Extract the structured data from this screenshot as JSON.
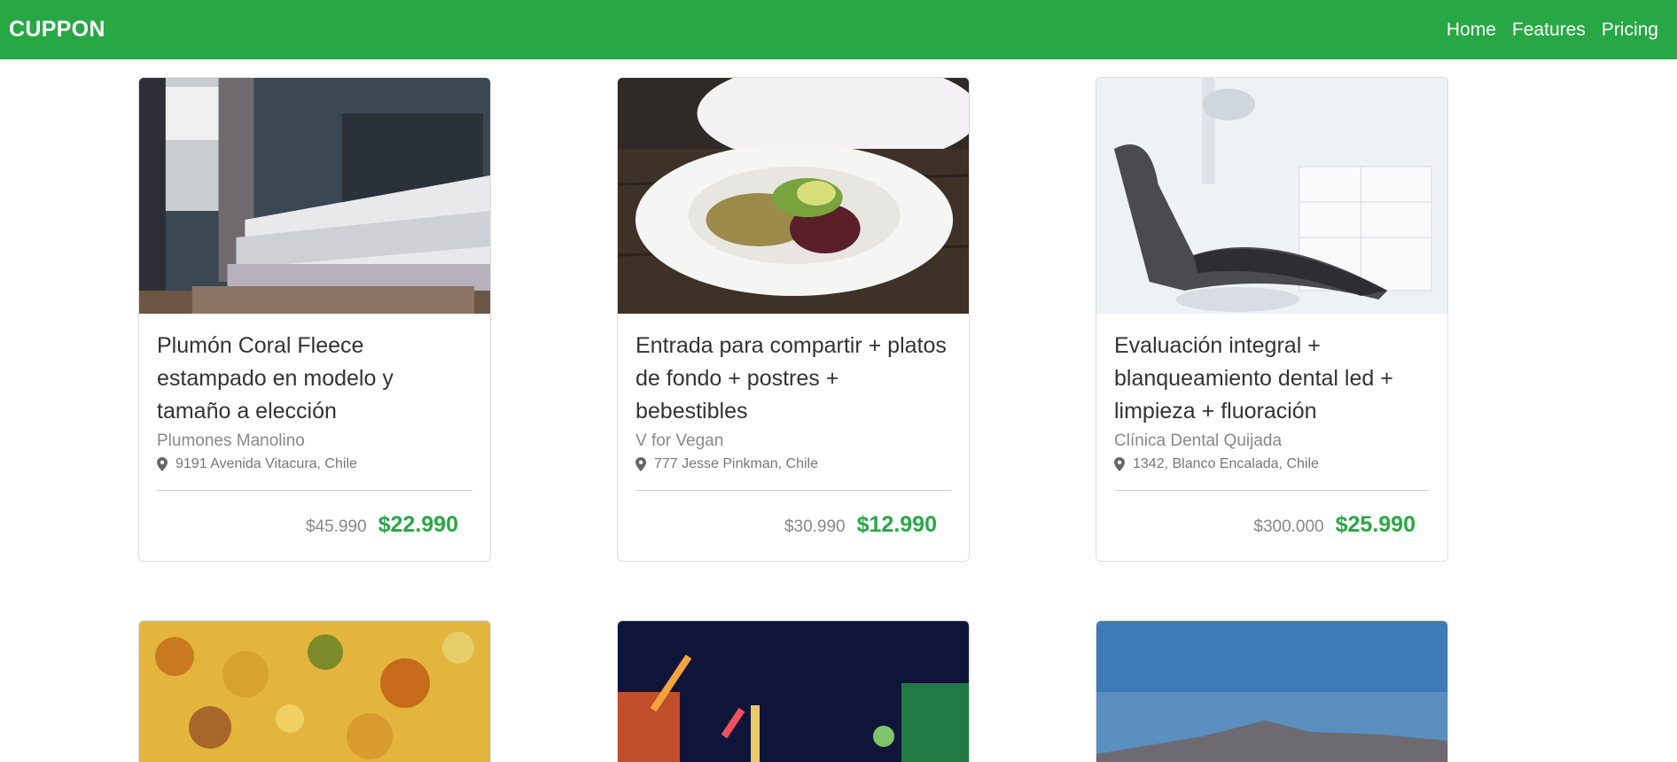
{
  "nav": {
    "brand": "CUPPON",
    "links": [
      "Home",
      "Features",
      "Pricing"
    ]
  },
  "cards": [
    {
      "title": "Plumón Coral Fleece estampado en modelo y tamaño a elección",
      "vendor": "Plumones Manolino",
      "location": "9191 Avenida Vitacura, Chile",
      "old_price": "$45.990",
      "new_price": "$22.990",
      "image_icon": "bedroom-photo"
    },
    {
      "title": "Entrada para compartir + platos de fondo + postres + bebestibles",
      "vendor": "V for Vegan",
      "location": "777 Jesse Pinkman, Chile",
      "old_price": "$30.990",
      "new_price": "$12.990",
      "image_icon": "salad-photo"
    },
    {
      "title": "Evaluación integral + blanqueamiento dental led + limpieza + fluoración",
      "vendor": "Clínica Dental Quijada",
      "location": "1342, Blanco Encalada, Chile",
      "old_price": "$300.000",
      "new_price": "$25.990",
      "image_icon": "dental-chair-photo"
    }
  ],
  "colors": {
    "brand_green": "#28a745",
    "muted": "#888888"
  }
}
